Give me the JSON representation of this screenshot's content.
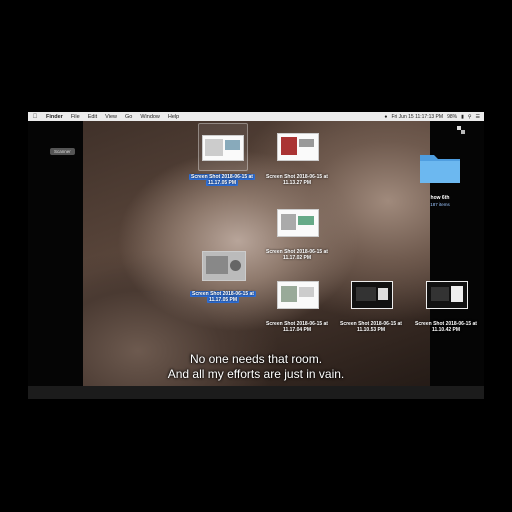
{
  "menubar": {
    "app": "Finder",
    "items": [
      "File",
      "Edit",
      "View",
      "Go",
      "Window",
      "Help"
    ],
    "status": "Fri Jun 15  11:17:13 PM",
    "battery": "98%"
  },
  "desktop": {
    "dock_button": "Scanner",
    "folder": {
      "name": "how 6th",
      "sub": "187 items"
    },
    "icons": [
      {
        "line1": "Screen Shot 2018-06-15 at",
        "line2": "11.17.05 PM",
        "selected": true
      },
      {
        "line1": "Screen Shot 2018-06-15 at",
        "line2": "11.13.27 PM",
        "selected": false
      },
      {
        "line1": "Screen Shot 2018-06-15 at",
        "line2": "11.17.02 PM",
        "selected": false
      },
      {
        "line1": "Screen Shot 2018-06-15 at",
        "line2": "11.17.05 PM",
        "selected": true
      },
      {
        "line1": "Screen Shot 2018-06-15 at",
        "line2": "11.17.04 PM",
        "selected": false
      },
      {
        "line1": "Screen Shot 2018-06-15 at",
        "line2": "11.10.53 PM",
        "selected": false
      },
      {
        "line1": "Screen Shot 2018-06-15 at",
        "line2": "11.10.42 PM",
        "selected": false
      }
    ]
  },
  "subtitles": {
    "line1": "No one needs that room.",
    "line2": "And all my efforts are just in vain."
  },
  "colors": {
    "selection": "#2f6fd6",
    "folder": "#5aa9e6"
  }
}
